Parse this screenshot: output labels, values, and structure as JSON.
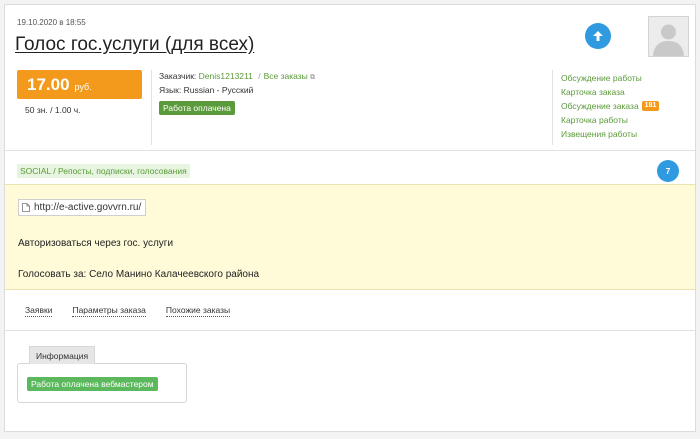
{
  "order": {
    "date": "19.10.2020 в 18:55",
    "title": "Голос гос.услуги (для всех)"
  },
  "price": {
    "amount": "17.00",
    "currency": "руб.",
    "meta": "50 зн.  /  1.00 ч."
  },
  "customer": {
    "label": "Заказчик:",
    "name": "Denis1213211",
    "separator": "/",
    "all_orders": "Все заказы",
    "language": "Язык: Russian - Русский",
    "status": "Работа оплачена"
  },
  "links": [
    {
      "label": "Обсуждение работы"
    },
    {
      "label": "Карточка заказа"
    },
    {
      "label": "Обсуждение заказа",
      "count": "181"
    },
    {
      "label": "Карточка работы"
    },
    {
      "label": "Извещения работы"
    }
  ],
  "category": {
    "label": "SOCIAL / Репосты, подписки, голосования",
    "badge": "7"
  },
  "description": {
    "url": "http://e-active.govvrn.ru/",
    "line1": "Авторизоваться через гос. услуги",
    "line2": "Голосовать за: Село Манино Калачеевского района"
  },
  "tabs": [
    "Заявки",
    "Параметры заказа",
    "Похожие заказы"
  ],
  "info": {
    "tab_label": "Информация",
    "badge": "Работа оплачена вебмастером"
  },
  "icons": {
    "up": "arrow-up-icon",
    "avatar": "user-silhouette-icon",
    "external": "external-link-icon",
    "file": "file-icon"
  },
  "colors": {
    "orange": "#f39a1c",
    "green": "#5b9a3a",
    "blue": "#2f9ae0",
    "highlight": "#fffbd9"
  }
}
